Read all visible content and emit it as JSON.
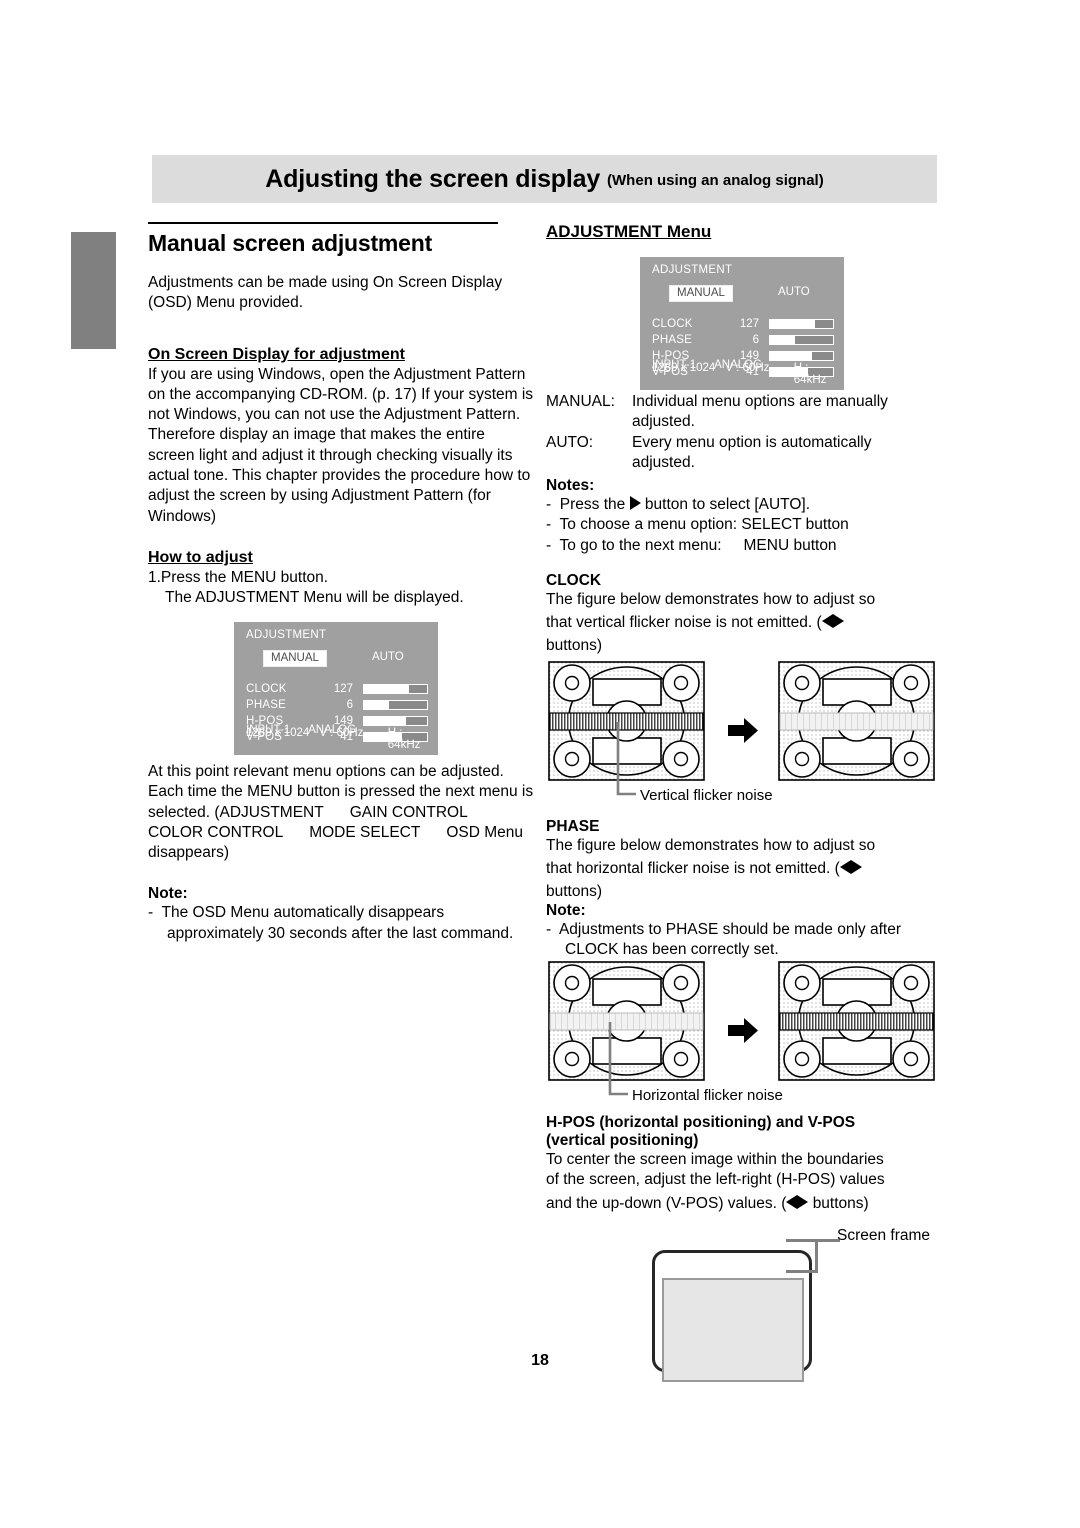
{
  "banner": {
    "title": "Adjusting the screen display",
    "subtitle": "(When using an analog signal)"
  },
  "page_number": "18",
  "left_column": {
    "section_title": "Manual screen adjustment",
    "intro": "Adjustments can be made using On Screen Display (OSD) Menu provided.",
    "osd_heading": "On Screen Display for adjustment",
    "osd_para": "If you are using Windows, open the Adjustment Pattern on the accompanying CD-ROM. (p. 17) If your system is not Windows, you can not use the Adjustment Pattern. Therefore display an image that makes the entire screen light and adjust it through checking visually its actual tone. This chapter provides the procedure how to adjust the screen by using Adjustment Pattern (for Windows)",
    "how_heading": "How to adjust",
    "step1_line1": "1.Press the MENU button.",
    "step1_line2": "The ADJUSTMENT Menu will be displayed.",
    "after_para1": "At this point relevant menu options can be adjusted.",
    "after_para2_a": "Each time the MENU button is pressed the next menu is selected. (ADJUSTMENT",
    "after_para2_b": "GAIN CONTROL",
    "after_para2_c": "COLOR CONTROL",
    "after_para2_d": "MODE SELECT",
    "after_para2_e": "OSD Menu disappears)",
    "note_heading": "Note:",
    "note_dash": "-",
    "note_text": "The OSD Menu automatically disappears approximately 30 seconds after the last command."
  },
  "right_column": {
    "adjustment_menu_heading": "ADJUSTMENT Menu",
    "manual_label": "MANUAL:",
    "manual_desc_line1": "Individual menu options are manually",
    "manual_desc_line2": "adjusted.",
    "auto_label": "AUTO:",
    "auto_desc_line1": "Every menu option is automatically",
    "auto_desc_line2": "adjusted.",
    "notes_heading": "Notes:",
    "notes": [
      {
        "dash": "-",
        "before": "Press the",
        "after": "button to select [AUTO]."
      },
      {
        "dash": "-",
        "before": "To choose a menu option: SELECT button",
        "after": ""
      },
      {
        "dash": "-",
        "before": "To go to the next menu:",
        "after": "MENU button"
      }
    ],
    "clock": {
      "heading": "CLOCK",
      "text_line1": "The figure below demonstrates how to adjust so",
      "text_line2": "that vertical flicker noise is not emitted. (",
      "text_line3": "buttons)",
      "figure_caption": "Vertical flicker noise"
    },
    "phase": {
      "heading": "PHASE",
      "text_line1": "The figure below demonstrates how to adjust so",
      "text_line2": "that horizontal flicker noise is not emitted. (",
      "text_line3": "buttons)",
      "note_heading": "Note:",
      "note_dash": "-",
      "note_text": "Adjustments to PHASE should be made only after CLOCK has been correctly set.",
      "figure_caption": "Horizontal flicker noise"
    },
    "pos": {
      "heading_line1": "H-POS (horizontal positioning) and V-POS",
      "heading_line2": "(vertical positioning)",
      "text_line1": "To center the screen image within the boundaries",
      "text_line2": "of the screen, adjust the left-right (H-POS) values",
      "text_line3a": "and the up-down (V-POS) values. (",
      "text_line3b": "buttons)",
      "frame_label": "Screen frame"
    }
  },
  "osd_menu": {
    "title": "ADJUSTMENT",
    "manual_button": "MANUAL",
    "auto_button": "AUTO",
    "rows": [
      {
        "label": "CLOCK",
        "value": "127",
        "fill_percent": 72
      },
      {
        "label": "PHASE",
        "value": "6",
        "fill_percent": 40
      },
      {
        "label": "H-POS",
        "value": "149",
        "fill_percent": 67
      },
      {
        "label": "V-POS",
        "value": "41",
        "fill_percent": 60
      }
    ],
    "input_label": "INPUT-1",
    "signal_label": "ANALOG",
    "resolution": "1280 x 1024",
    "vfreq": "V : 60Hz",
    "hfreq": "H : 64kHz"
  },
  "colors": {
    "banner_bg": "#dcdcdc",
    "edge_tab": "#808080",
    "osd_bg": "#a0a0a0",
    "osd_text": "#ffffff",
    "frame_inner": "#e6e6e6"
  }
}
